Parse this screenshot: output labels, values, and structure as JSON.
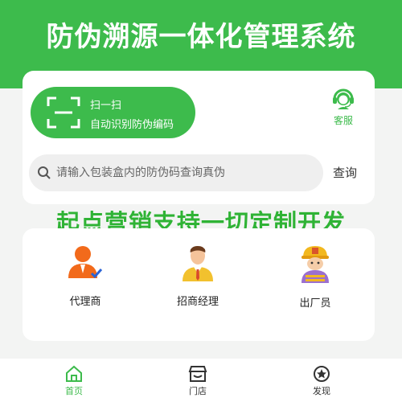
{
  "banner": {
    "title": "防伪溯源一体化管理系统"
  },
  "scan": {
    "title": "扫一扫",
    "subtitle": "自动识别防伪编码"
  },
  "service": {
    "label": "客服",
    "icon": "headset-agent-icon"
  },
  "search": {
    "placeholder": "请输入包装盒内的防伪码查询真伪",
    "button_label": "查询"
  },
  "slogan": "起点营销支持一切定制开发",
  "roles": [
    {
      "label": "代理商",
      "icon": "agent-icon"
    },
    {
      "label": "招商经理",
      "icon": "manager-icon"
    },
    {
      "label": "出厂员",
      "icon": "factory-worker-icon"
    }
  ],
  "tabs": [
    {
      "label": "首页",
      "icon": "home-icon",
      "active": true
    },
    {
      "label": "门店",
      "icon": "store-icon",
      "active": false
    },
    {
      "label": "发现",
      "icon": "discover-icon",
      "active": false
    }
  ],
  "colors": {
    "brand_green": "#3dbb4c",
    "slogan_green": "#2fb335",
    "background": "#f3f4f3"
  }
}
